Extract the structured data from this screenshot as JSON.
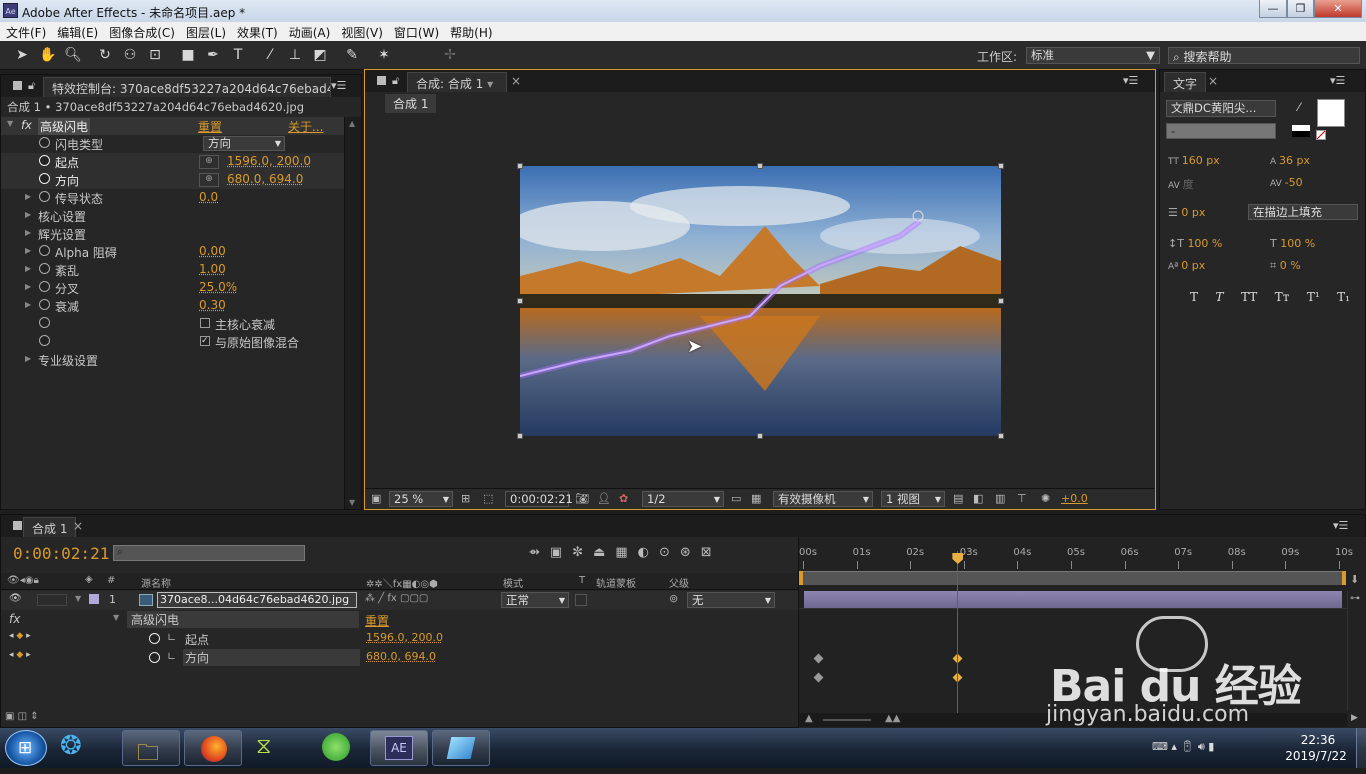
{
  "window": {
    "title": "Adobe After Effects - 未命名项目.aep *",
    "app_icon": "Ae",
    "minimize": "—",
    "restore": "❐",
    "close": "✕"
  },
  "menu": [
    "文件(F)",
    "编辑(E)",
    "图像合成(C)",
    "图层(L)",
    "效果(T)",
    "动画(A)",
    "视图(V)",
    "窗口(W)",
    "帮助(H)"
  ],
  "toolbar": {
    "workspace_label": "工作区:",
    "workspace_value": "标准",
    "search_help": "搜索帮助"
  },
  "effects_panel": {
    "tab": "特效控制台: 370ace8df53227a204d64c76ebad4620.jp",
    "subtitle": "合成 1 • 370ace8df53227a204d64c76ebad4620.jpg",
    "effect_name": "高级闪电",
    "reset": "重置",
    "about": "关于...",
    "props": [
      {
        "name": "闪电类型",
        "value": "方向"
      },
      {
        "name": "起点",
        "value": "1596.0, 200.0"
      },
      {
        "name": "方向",
        "value": "680.0, 694.0"
      },
      {
        "name": "传导状态",
        "value": "0.0"
      },
      {
        "name": "核心设置",
        "value": ""
      },
      {
        "name": "辉光设置",
        "value": ""
      },
      {
        "name": "Alpha 阻碍",
        "value": "0.00"
      },
      {
        "name": "紊乱",
        "value": "1.00"
      },
      {
        "name": "分叉",
        "value": "25.0%"
      },
      {
        "name": "衰减",
        "value": "0.30"
      },
      {
        "name": "",
        "value": "主核心衰减"
      },
      {
        "name": "",
        "value": "与原始图像混合"
      },
      {
        "name": "专业级设置",
        "value": ""
      }
    ]
  },
  "comp_panel": {
    "tab": "合成: 合成 1",
    "subtab": "合成 1",
    "zoom": "25 %",
    "timecode": "0:00:02:21",
    "resolution": "1/2",
    "camera": "有效摄像机",
    "views": "1 视图",
    "exposure": "+0.0"
  },
  "text_panel": {
    "tab": "文字",
    "font": "文鼎DC黄阳尖...",
    "style": "-",
    "size": "160 px",
    "leading": "36 px",
    "kerning": "度",
    "tracking": "-50",
    "stroke": "0 px",
    "stroke_mode": "在描边上填充",
    "vscale": "100 %",
    "hscale": "100 %",
    "baseline": "0 px",
    "tsume": "0 %",
    "styles": [
      "T",
      "T",
      "TT",
      "Tт",
      "T¹",
      "T₁"
    ]
  },
  "timeline": {
    "tab": "合成 1",
    "timecode": "0:00:02:21",
    "col_source": "源名称",
    "col_mode": "模式",
    "col_t": "T",
    "col_track": "轨道蒙板",
    "col_parent": "父级",
    "layer_num": "1",
    "layer_name": "370ace8...04d64c76ebad4620.jpg",
    "mode": "正常",
    "parent": "无",
    "effect_name": "高级闪电",
    "reset": "重置",
    "prop1_name": "起点",
    "prop1_value": "1596.0, 200.0",
    "prop2_name": "方向",
    "prop2_value": "680.0, 694.0",
    "ruler": [
      "00s",
      "01s",
      "02s",
      "03s",
      "04s",
      "05s",
      "06s",
      "07s",
      "08s",
      "09s",
      "10s"
    ],
    "playhead_seconds": 2.88
  },
  "watermark": {
    "brand": "Bai du 经验",
    "url": "jingyan.baidu.com"
  },
  "clock": {
    "time": "22:36",
    "date": "2019/7/22"
  }
}
